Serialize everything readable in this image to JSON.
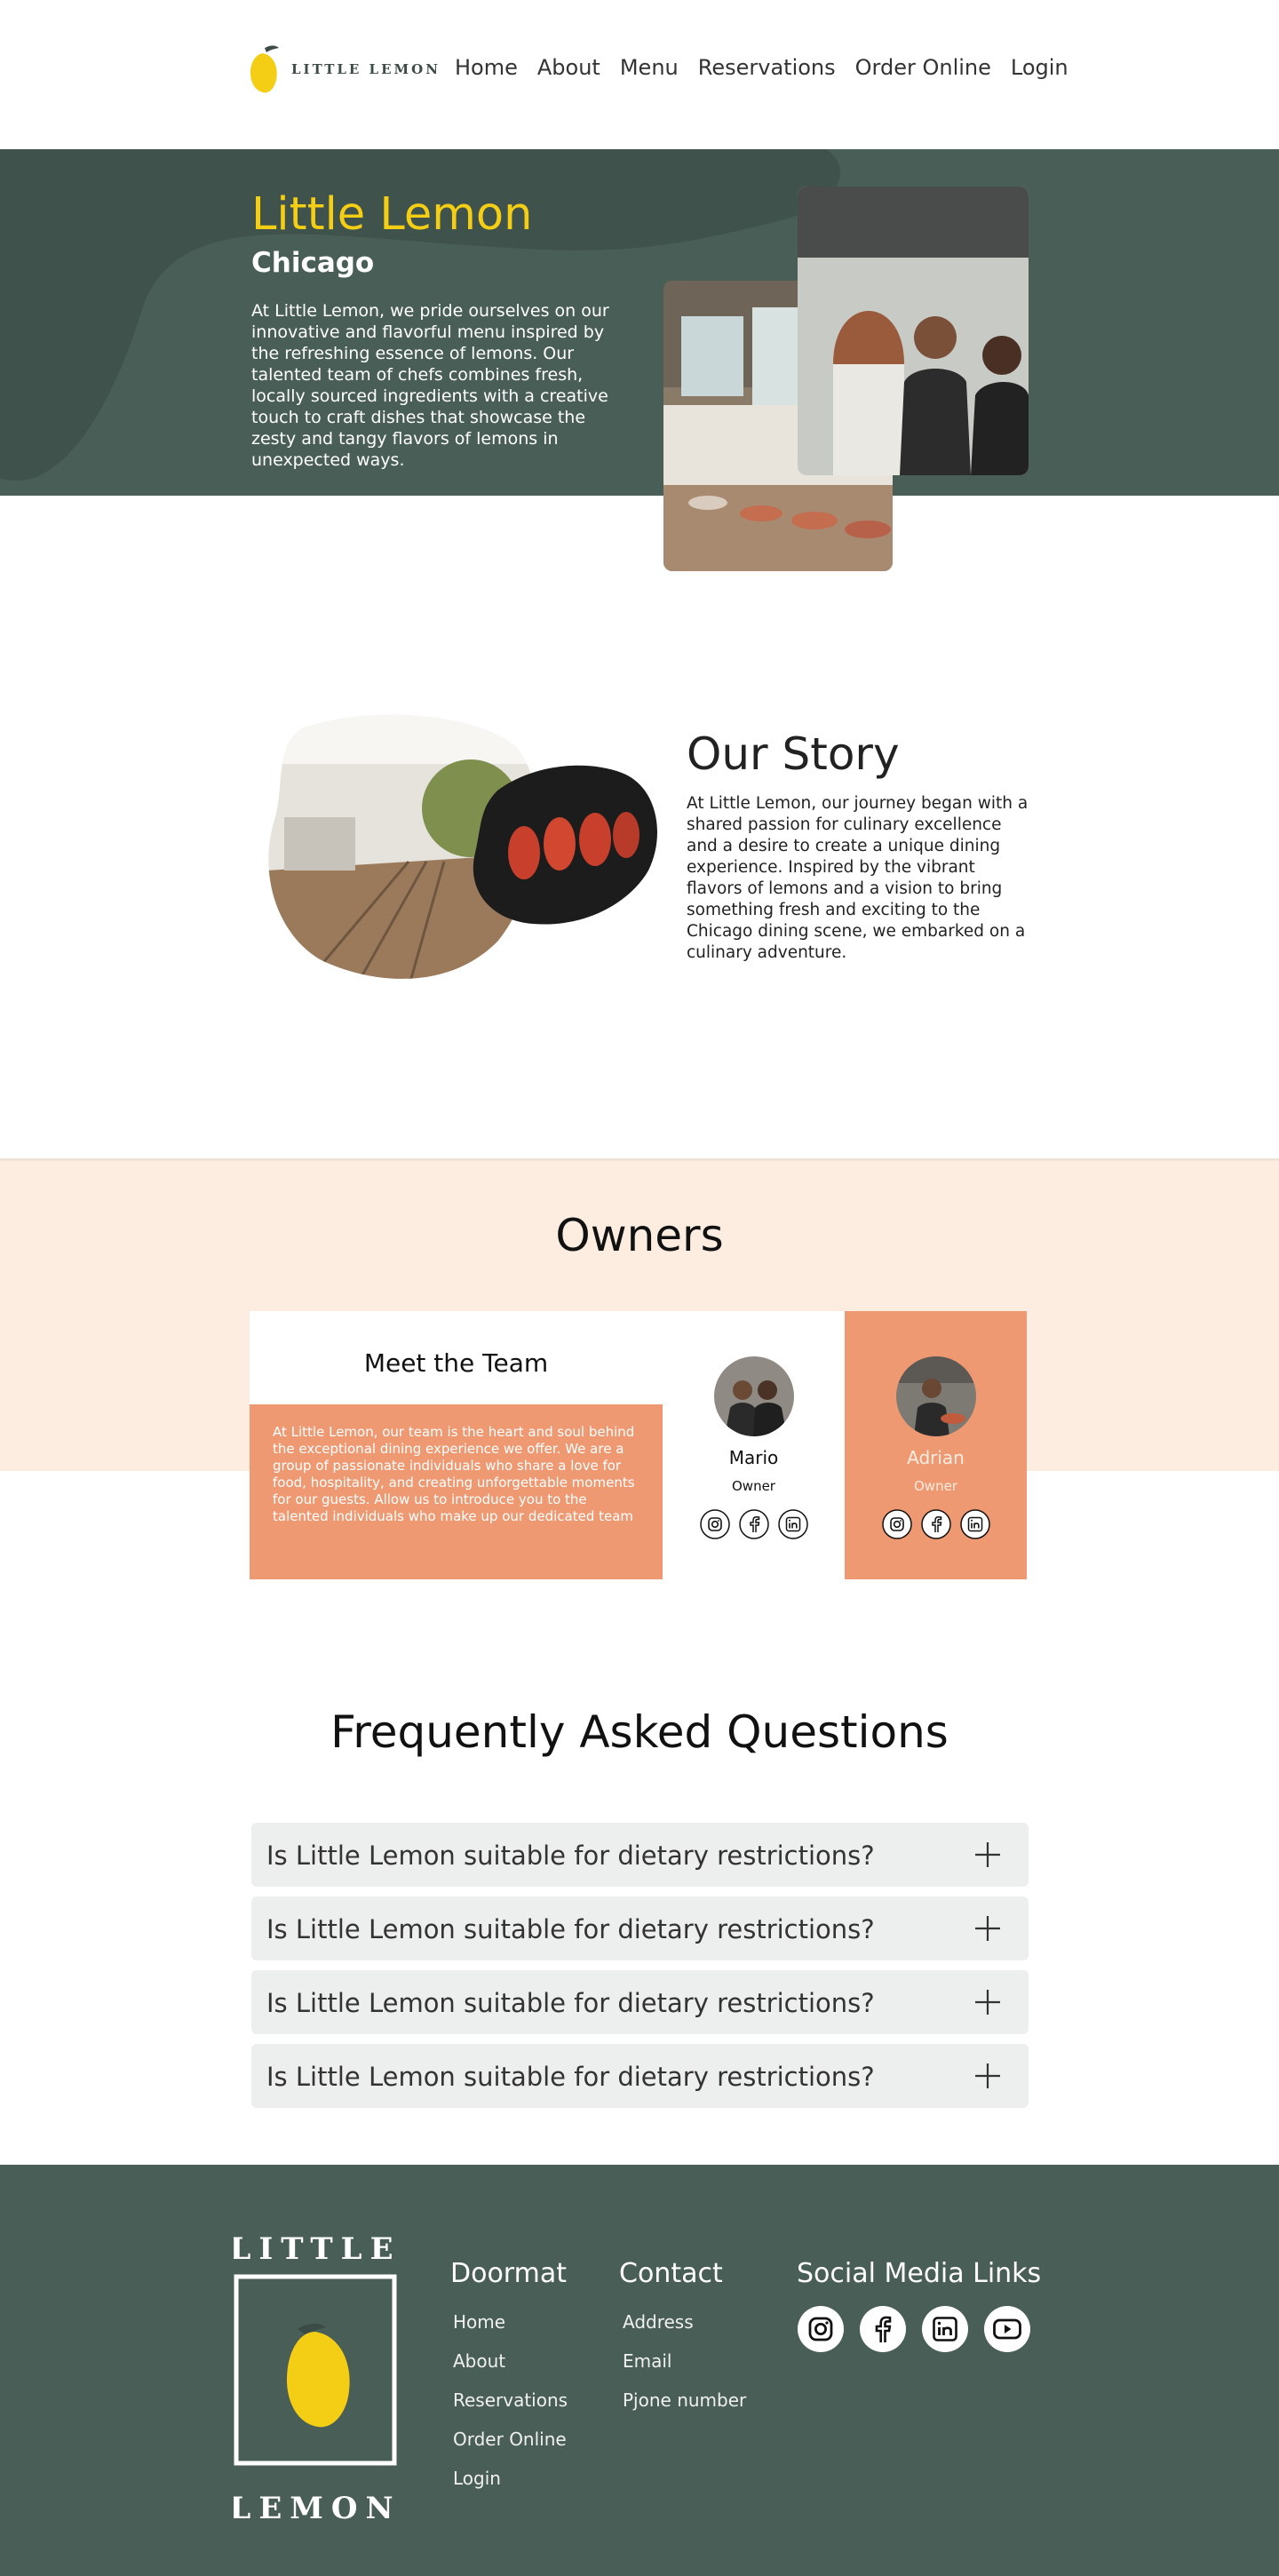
{
  "brand": {
    "logo_text": "LITTLE LEMON",
    "accent_yellow": "#f4ce14",
    "accent_green": "#495e57",
    "accent_salmon": "#ee9972",
    "accent_peach": "#fcede0"
  },
  "nav": {
    "items": [
      {
        "label": "Home"
      },
      {
        "label": "About"
      },
      {
        "label": "Menu"
      },
      {
        "label": "Reservations"
      },
      {
        "label": "Order Online"
      },
      {
        "label": "Login"
      }
    ]
  },
  "hero": {
    "title": "Little Lemon",
    "subtitle": "Chicago",
    "text": "At Little Lemon, we pride ourselves on our innovative and flavorful menu inspired by the refreshing essence of lemons. Our talented team of chefs combines fresh, locally sourced ingredients with a creative touch to craft dishes that showcase the zesty and tangy flavors of lemons in unexpected ways."
  },
  "story": {
    "title": "Our Story",
    "text": "At Little Lemon, our journey began with a shared passion for culinary excellence and a desire to create a unique dining experience. Inspired by the vibrant flavors of lemons and a vision to bring something fresh and exciting to the Chicago dining scene, we embarked on a culinary adventure."
  },
  "owners": {
    "title": "Owners",
    "team_heading": "Meet the Team",
    "team_text": "At Little Lemon, our team is the heart and soul behind the exceptional dining experience we offer. We are a group of passionate individuals who share a love for food, hospitality, and creating unforgettable moments for our guests. Allow us to introduce you to the talented individuals who make up our dedicated team",
    "people": [
      {
        "name": "Mario",
        "role": "Owner",
        "social": [
          "instagram-icon",
          "facebook-icon",
          "linkedin-icon"
        ]
      },
      {
        "name": "Adrian",
        "role": "Owner",
        "social": [
          "instagram-icon",
          "facebook-icon",
          "linkedin-icon"
        ]
      }
    ]
  },
  "faq": {
    "title": "Frequently Asked Questions",
    "items": [
      {
        "question": "Is Little Lemon suitable for dietary restrictions?",
        "icon": "plus-icon"
      },
      {
        "question": "Is Little Lemon suitable for dietary restrictions?",
        "icon": "plus-icon"
      },
      {
        "question": "Is Little Lemon suitable for dietary restrictions?",
        "icon": "plus-icon"
      },
      {
        "question": "Is Little Lemon suitable for dietary restrictions?",
        "icon": "plus-icon"
      }
    ]
  },
  "footer": {
    "logo_top": "LITTLE",
    "logo_bottom": "LEMON",
    "doormat": {
      "heading": "Doormat",
      "links": [
        "Home",
        "About",
        "Reservations",
        "Order Online",
        "Login"
      ]
    },
    "contact": {
      "heading": "Contact",
      "links": [
        "Address",
        "Email",
        "Pjone number"
      ]
    },
    "social": {
      "heading": "Social Media Links",
      "icons": [
        "instagram-icon",
        "facebook-icon",
        "linkedin-icon",
        "youtube-icon"
      ]
    }
  }
}
